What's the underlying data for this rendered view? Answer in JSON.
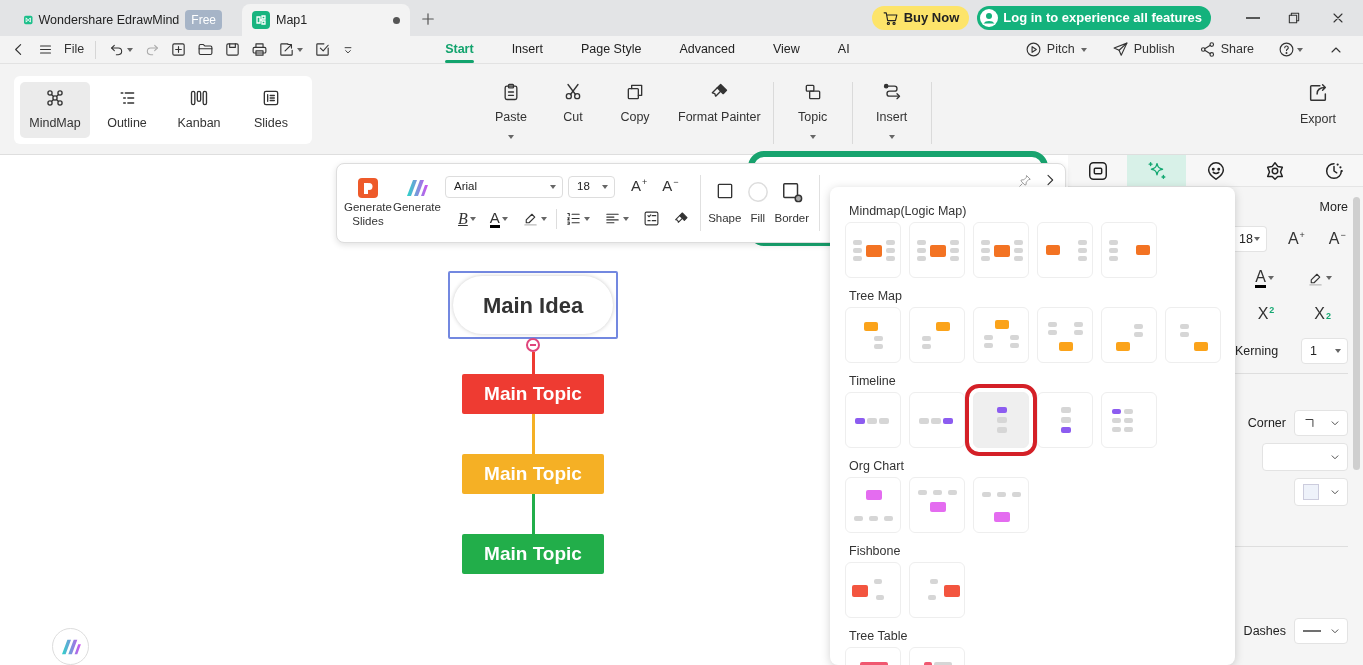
{
  "tabs": [
    {
      "kind": "app",
      "label": "Wondershare EdrawMind",
      "badge": "Free",
      "selected": false
    },
    {
      "kind": "document",
      "label": "Map1",
      "selected": true,
      "modified": true
    }
  ],
  "header_buttons": {
    "buy": "Buy Now",
    "login": "Log in to experience all features"
  },
  "menu": {
    "file": "File",
    "tabs": [
      {
        "label": "Start",
        "selected": true
      },
      {
        "label": "Insert",
        "selected": false
      },
      {
        "label": "Page Style",
        "selected": false
      },
      {
        "label": "Advanced",
        "selected": false
      },
      {
        "label": "View",
        "selected": false
      },
      {
        "label": "AI",
        "selected": false
      }
    ],
    "actions": [
      {
        "label": "Pitch",
        "dropdown": true
      },
      {
        "label": "Publish",
        "dropdown": false
      },
      {
        "label": "Share",
        "dropdown": false
      }
    ]
  },
  "ribbon": {
    "views": [
      {
        "label": "MindMap",
        "selected": true
      },
      {
        "label": "Outline",
        "selected": false
      },
      {
        "label": "Kanban",
        "selected": false
      },
      {
        "label": "Slides",
        "selected": false
      }
    ],
    "tools": [
      {
        "label": "Paste",
        "dropdown": true
      },
      {
        "label": "Cut",
        "dropdown": false
      },
      {
        "label": "Copy",
        "dropdown": false
      },
      {
        "label": "Format Painter",
        "dropdown": false
      },
      {
        "label": "Topic",
        "dropdown": true
      },
      {
        "label": "Insert",
        "dropdown": true
      }
    ],
    "export": "Export"
  },
  "format_bar": {
    "generate_slides": "Generate Slides",
    "generate": "Generate",
    "font": "Arial",
    "size": "18",
    "grow": "A$^{+}$",
    "shrink": "A$^{−}$",
    "bold": "B",
    "font_color": "A",
    "shape": "Shape",
    "fill": "Fill",
    "border": "Border"
  },
  "map": {
    "root": "Main Idea",
    "topics": [
      {
        "label": "Main Topic",
        "color": "#ee3b32"
      },
      {
        "label": "Main Topic",
        "color": "#f5b025"
      },
      {
        "label": "Main Topic",
        "color": "#22ae4a"
      }
    ]
  },
  "layout_panel": {
    "sections": [
      {
        "title": "Mindmap(Logic Map)",
        "color": "#f37323",
        "layouts": [
          {
            "selected": false
          },
          {
            "selected": false
          },
          {
            "selected": false
          },
          {
            "selected": false
          },
          {
            "selected": false
          }
        ]
      },
      {
        "title": "Tree Map",
        "color": "#fba31a",
        "layouts": [
          {
            "selected": false
          },
          {
            "selected": false
          },
          {
            "selected": false
          },
          {
            "selected": false
          },
          {
            "selected": false
          },
          {
            "selected": false
          }
        ]
      },
      {
        "title": "Timeline",
        "color": "#8c5cf0",
        "layouts": [
          {
            "selected": false
          },
          {
            "selected": false
          },
          {
            "selected": true
          },
          {
            "selected": false
          },
          {
            "selected": false
          }
        ]
      },
      {
        "title": "Org Chart",
        "color": "#e46cf0",
        "layouts": [
          {
            "selected": false
          },
          {
            "selected": false
          },
          {
            "selected": false
          }
        ]
      },
      {
        "title": "Fishbone",
        "color": "#f3553f",
        "layouts": [
          {
            "selected": false
          },
          {
            "selected": false
          }
        ]
      },
      {
        "title": "Tree Table",
        "color": "#f05870",
        "layouts": [
          {
            "selected": false
          },
          {
            "selected": false
          }
        ]
      }
    ]
  },
  "side_panel": {
    "tabs": [
      {
        "selected": false
      },
      {
        "selected": true
      },
      {
        "selected": false
      },
      {
        "selected": false
      },
      {
        "selected": false
      }
    ],
    "more": "More",
    "size": "18",
    "grow": "A$^{+}$",
    "shrink": "A$^{−}$",
    "font_color": "A",
    "superscript": "X$^{2}$",
    "subscript": "X$_{2}$",
    "kerning_label": "Kerning",
    "kerning": "1",
    "corner_label": "Corner",
    "dashes_label": "Dashes"
  }
}
